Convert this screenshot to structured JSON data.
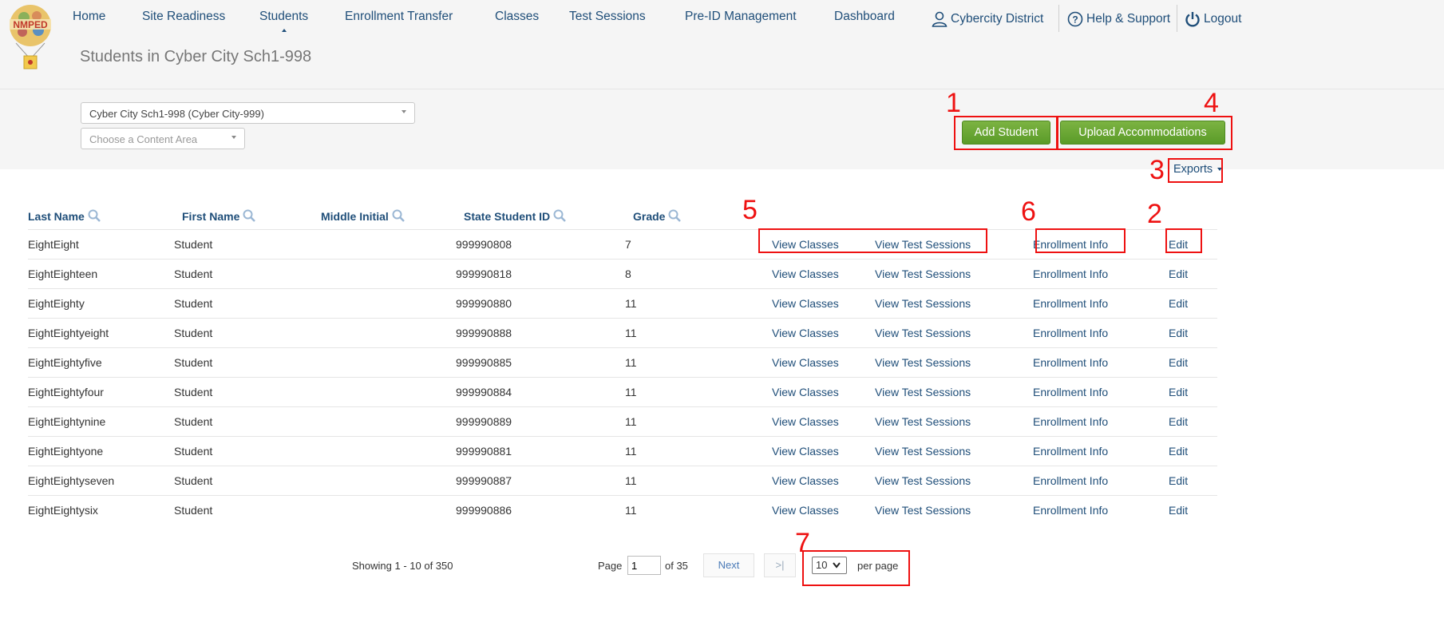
{
  "header": {
    "logo_text": "NMPED",
    "nav": [
      {
        "label": "Home"
      },
      {
        "label": "Site Readiness"
      },
      {
        "label": "Students"
      },
      {
        "label": "Enrollment Transfer"
      },
      {
        "label": "Classes"
      },
      {
        "label": "Test Sessions"
      },
      {
        "label": "Pre-ID Management"
      },
      {
        "label": "Dashboard"
      }
    ],
    "account_label": "Cybercity District",
    "help_label": "Help & Support",
    "logout_label": "Logout",
    "active_nav": "Students"
  },
  "page_title": "Students in Cyber City Sch1-998",
  "filters": {
    "school_select": "Cyber City Sch1-998 (Cyber City-999)",
    "content_area_placeholder": "Choose a Content Area"
  },
  "actions": {
    "add_student": "Add Student",
    "upload_accommodations": "Upload Accommodations",
    "exports": "Exports"
  },
  "table": {
    "columns": [
      "Last Name",
      "First Name",
      "Middle Initial",
      "State Student ID",
      "Grade"
    ],
    "link_labels": {
      "view_classes": "View Classes",
      "view_test_sessions": "View Test Sessions",
      "enrollment_info": "Enrollment Info",
      "edit": "Edit"
    },
    "rows": [
      {
        "last": "EightEight",
        "first": "Student",
        "middle": "",
        "id": "999990808",
        "grade": "7"
      },
      {
        "last": "EightEighteen",
        "first": "Student",
        "middle": "",
        "id": "999990818",
        "grade": "8"
      },
      {
        "last": "EightEighty",
        "first": "Student",
        "middle": "",
        "id": "999990880",
        "grade": "11"
      },
      {
        "last": "EightEightyeight",
        "first": "Student",
        "middle": "",
        "id": "999990888",
        "grade": "11"
      },
      {
        "last": "EightEightyfive",
        "first": "Student",
        "middle": "",
        "id": "999990885",
        "grade": "11"
      },
      {
        "last": "EightEightyfour",
        "first": "Student",
        "middle": "",
        "id": "999990884",
        "grade": "11"
      },
      {
        "last": "EightEightynine",
        "first": "Student",
        "middle": "",
        "id": "999990889",
        "grade": "11"
      },
      {
        "last": "EightEightyone",
        "first": "Student",
        "middle": "",
        "id": "999990881",
        "grade": "11"
      },
      {
        "last": "EightEightyseven",
        "first": "Student",
        "middle": "",
        "id": "999990887",
        "grade": "11"
      },
      {
        "last": "EightEightysix",
        "first": "Student",
        "middle": "",
        "id": "999990886",
        "grade": "11"
      }
    ]
  },
  "pagination": {
    "showing": "Showing 1 - 10 of 350",
    "page_label": "Page",
    "page_value": "1",
    "of_label": "of 35",
    "next_label": "Next",
    "last_label": ">|",
    "per_page_value": "10",
    "per_page_label": "per page"
  },
  "annotations": [
    "1",
    "2",
    "3",
    "4",
    "5",
    "6",
    "7"
  ],
  "colors": {
    "link": "#1f4e79",
    "button_green": "#5a9b28",
    "annotation_red": "#ee1111",
    "header_bg": "#f5f5f5"
  }
}
